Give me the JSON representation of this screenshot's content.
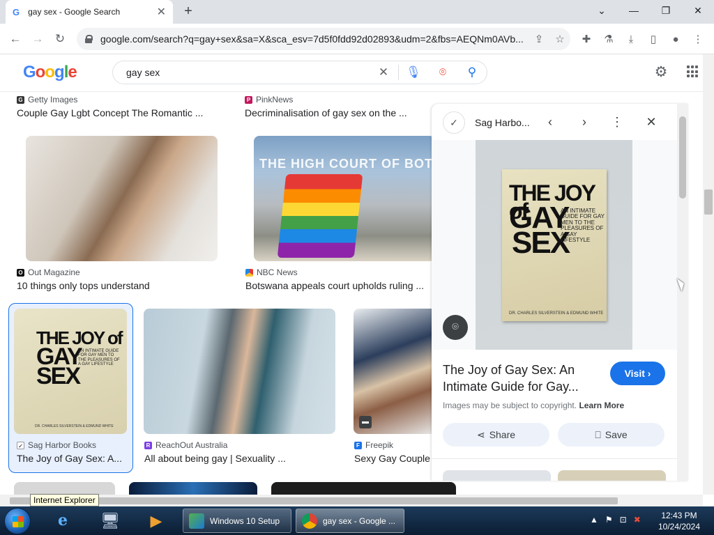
{
  "browser": {
    "tab_title": "gay sex - Google Search",
    "tab_favicon": "G",
    "url": "google.com/search?q=gay+sex&sa=X&sca_esv=7d5f0fdd92d02893&udm=2&fbs=AEQNm0AVb..."
  },
  "google": {
    "logo": "Google",
    "query": "gay sex"
  },
  "results": [
    {
      "source": "Getty Images",
      "title": "Couple Gay Lgbt Concept The Romantic ..."
    },
    {
      "source": "PinkNews",
      "title": "Decriminalisation of gay sex on the ..."
    },
    {
      "source": "Out Magazine",
      "title": "10 things only tops understand"
    },
    {
      "source": "NBC News",
      "title": "Botswana appeals court upholds ruling ..."
    },
    {
      "source": "Sag Harbor Books",
      "title": "The Joy of Gay Sex: A..."
    },
    {
      "source": "ReachOut Australia",
      "title": "All about being gay | Sexuality ..."
    },
    {
      "source": "Freepik",
      "title": "Sexy Gay Couple"
    }
  ],
  "court_sign": "THE HIGH COURT OF BOTSW",
  "book": {
    "title_line1": "THE JOY of",
    "title_line2": "GAY",
    "title_line3": "SEX",
    "subtitle": "AN INTIMATE GUIDE FOR GAY MEN TO THE PLEASURES OF A GAY LIFESTYLE",
    "authors": "DR. CHARLES SILVERSTEIN & EDMUND WHITE"
  },
  "panel": {
    "source": "Sag Harbo...",
    "title": "The Joy of Gay Sex: An Intimate Guide for Gay...",
    "visit_label": "Visit",
    "copyright": "Images may be subject to copyright.",
    "learn_more": "Learn More",
    "share_label": "Share",
    "save_label": "Save"
  },
  "tooltip": "Internet Explorer",
  "taskbar": {
    "task1": "Windows 10 Setup",
    "task2": "gay sex - Google ...",
    "time": "12:43 PM",
    "date": "10/24/2024"
  },
  "colors": {
    "accent": "#1a73e8",
    "chrome_bg": "#dee1e6",
    "taskbar": "#0b1d33"
  }
}
